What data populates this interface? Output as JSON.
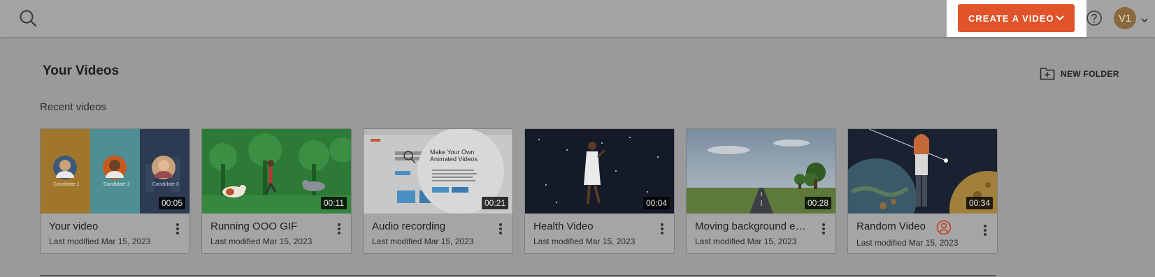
{
  "header": {
    "create_label": "CREATE A VIDEO",
    "avatar_initials": "V1",
    "accent": "#e0532b"
  },
  "page": {
    "title": "Your Videos",
    "new_folder_label": "NEW FOLDER",
    "section_label": "Recent videos"
  },
  "videos": [
    {
      "title": "Your video",
      "modified": "Last modified Mar 15, 2023",
      "duration": "00:05",
      "thumb_labels": [
        "Candidate 1",
        "Candidate 2",
        "Candidate 3"
      ]
    },
    {
      "title": "Running OOO GIF",
      "modified": "Last modified Mar 15, 2023",
      "duration": "00:11"
    },
    {
      "title": "Audio recording",
      "modified": "Last modified Mar 15, 2023",
      "duration": "00:21",
      "thumb_heading": "Make Your Own Animated Videos"
    },
    {
      "title": "Health Video",
      "modified": "Last modified Mar 15, 2023",
      "duration": "00:04"
    },
    {
      "title": "Moving background exa...",
      "modified": "Last modified Mar 15, 2023",
      "duration": "00:28"
    },
    {
      "title": "Random Video",
      "modified": "Last modified Mar 15, 2023",
      "duration": "00:34",
      "owner_icon": "user-circle-icon"
    }
  ]
}
